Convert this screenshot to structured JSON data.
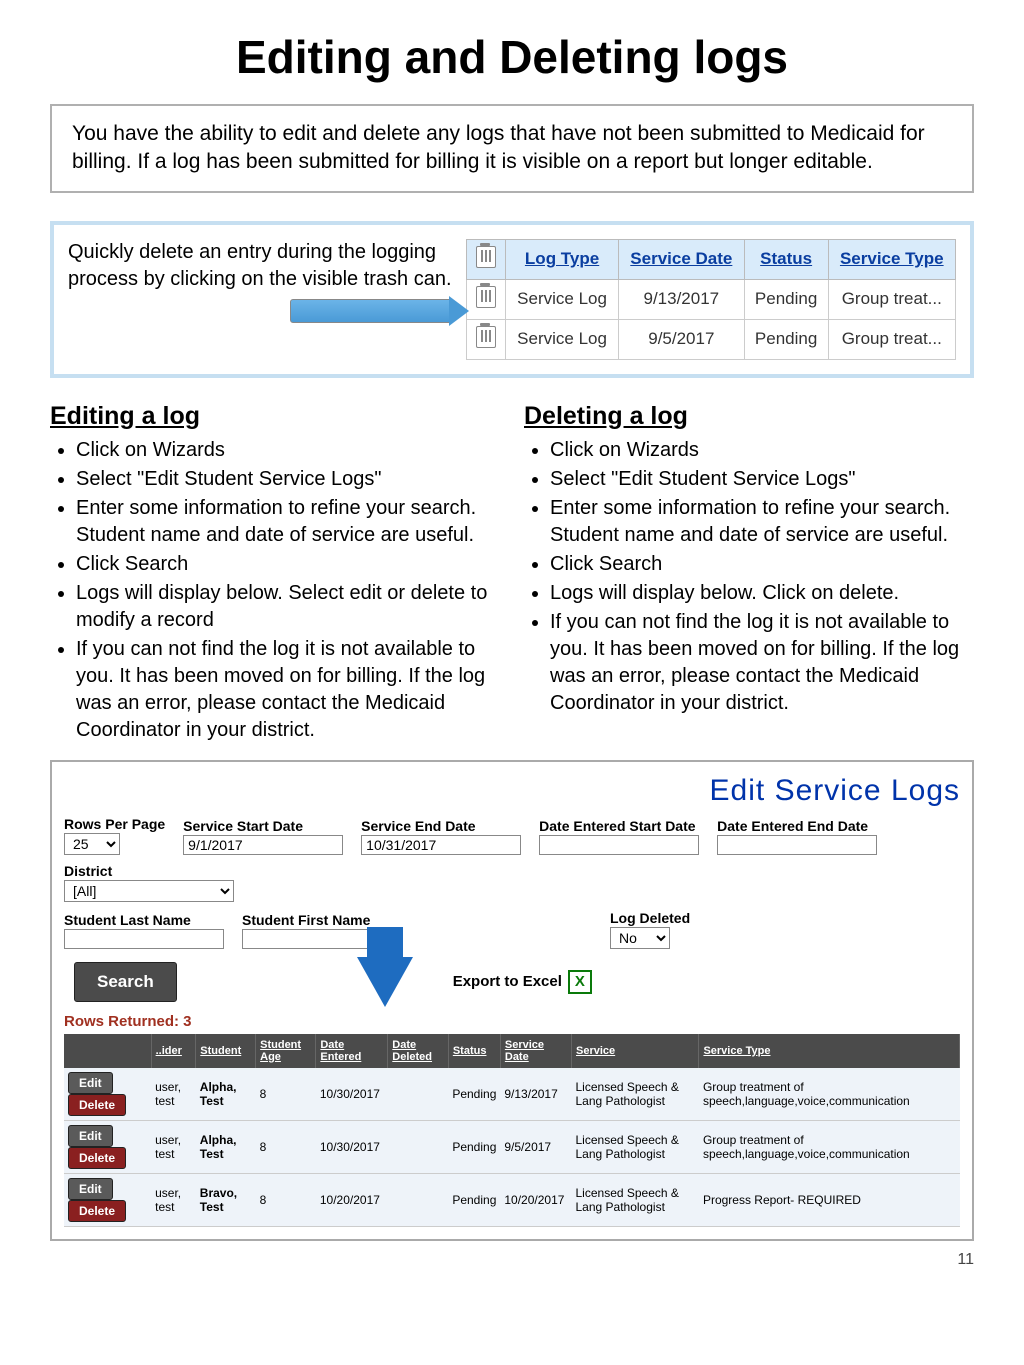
{
  "title": "Editing and Deleting logs",
  "intro": "You have the ability to edit and delete any logs that have not been submitted to Medicaid for billing. If a log has been submitted for billing it is visible on a report but longer editable.",
  "deleteCallout": "Quickly delete an entry during the logging process by clicking on the visible trash can.",
  "logTable": {
    "headers": [
      "",
      "Log Type",
      "Service Date",
      "Status",
      "Service Type"
    ],
    "rows": [
      {
        "logType": "Service Log",
        "serviceDate": "9/13/2017",
        "status": "Pending",
        "serviceType": "Group treat..."
      },
      {
        "logType": "Service Log",
        "serviceDate": "9/5/2017",
        "status": "Pending",
        "serviceType": "Group treat..."
      }
    ]
  },
  "editing": {
    "heading": "Editing a log",
    "items": [
      "Click on Wizards",
      "Select \"Edit Student Service Logs\"",
      "Enter some information to refine your search. Student name and date of service are useful.",
      "Click Search",
      "Logs will display  below. Select edit or delete to modify a record",
      "If you can not find the log it is not available to you. It has been moved on for billing.  If the log was an error, please contact the Medicaid Coordinator in your district."
    ]
  },
  "deleting": {
    "heading": "Deleting a log",
    "items": [
      "Click on Wizards",
      "Select \"Edit Student Service Logs\"",
      "Enter some information to refine your search. Student name and date of service are useful.",
      "Click Search",
      "Logs will display  below. Click on delete.",
      "If you can not find the log it is not available to you. It has been moved on for billing.  If the log was an error, please contact the Medicaid Coordinator in your district."
    ]
  },
  "form": {
    "title": "Edit Service Logs",
    "rowsPerPageLabel": "Rows Per Page",
    "rowsPerPageValue": "25",
    "serviceStartLabel": "Service Start Date",
    "serviceStartValue": "9/1/2017",
    "serviceEndLabel": "Service End Date",
    "serviceEndValue": "10/31/2017",
    "dateEnteredStartLabel": "Date Entered Start Date",
    "dateEnteredEndLabel": "Date Entered End Date",
    "districtLabel": "District",
    "districtValue": "[All]",
    "lastNameLabel": "Student Last Name",
    "firstNameLabel": "Student First Name",
    "logDeletedLabel": "Log Deleted",
    "logDeletedValue": "No",
    "searchLabel": "Search",
    "exportLabel": "Export to Excel",
    "rowsReturned": "Rows Returned: 3"
  },
  "results": {
    "headers": [
      "",
      "..ider",
      "Student",
      "Student Age",
      "Date Entered",
      "Date Deleted",
      "Status",
      "Service Date",
      "Service",
      "Service Type"
    ],
    "editLabel": "Edit",
    "deleteLabel": "Delete",
    "rows": [
      {
        "ider": "user, test",
        "student": "Alpha, Test",
        "age": "8",
        "entered": "10/30/2017",
        "deleted": "",
        "status": "Pending",
        "sdate": "9/13/2017",
        "service": "Licensed Speech & Lang Pathologist",
        "stype": "Group treatment of speech,language,voice,communication"
      },
      {
        "ider": "user, test",
        "student": "Alpha, Test",
        "age": "8",
        "entered": "10/30/2017",
        "deleted": "",
        "status": "Pending",
        "sdate": "9/5/2017",
        "service": "Licensed Speech & Lang Pathologist",
        "stype": "Group treatment of speech,language,voice,communication"
      },
      {
        "ider": "user, test",
        "student": "Bravo, Test",
        "age": "8",
        "entered": "10/20/2017",
        "deleted": "",
        "status": "Pending",
        "sdate": "10/20/2017",
        "service": "Licensed Speech & Lang Pathologist",
        "stype": "Progress Report- REQUIRED"
      }
    ]
  },
  "pageNumber": "11"
}
